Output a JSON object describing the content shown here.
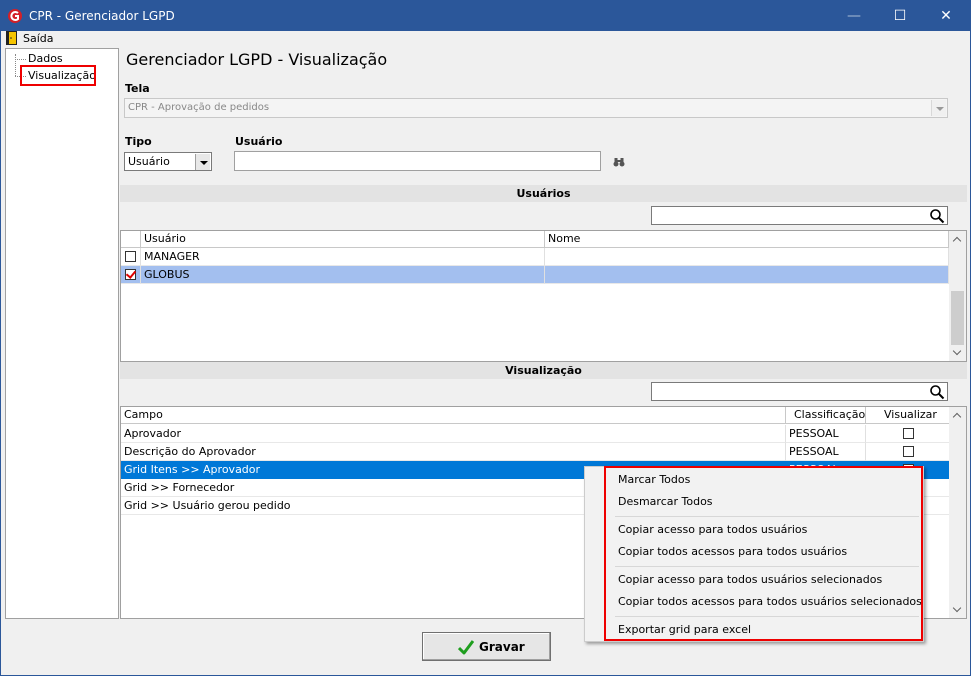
{
  "window": {
    "title": "CPR - Gerenciador LGPD",
    "minimize": "—",
    "maximize": "☐",
    "close": "✕"
  },
  "menu": {
    "exit_label": "Saída"
  },
  "tree": {
    "items": [
      "Dados",
      "Visualização"
    ]
  },
  "page": {
    "title": "Gerenciador LGPD - Visualização"
  },
  "form": {
    "tela_label": "Tela",
    "tela_value": "CPR - Aprovação de pedidos",
    "tipo_label": "Tipo",
    "tipo_value": "Usuário",
    "usuario_label": "Usuário",
    "usuario_value": ""
  },
  "users_section": {
    "title": "Usuários",
    "search_value": "",
    "columns": [
      "Usuário",
      "Nome"
    ],
    "rows": [
      {
        "usuario": "MANAGER",
        "nome": "",
        "checked": false
      },
      {
        "usuario": "GLOBUS",
        "nome": "",
        "checked": true
      }
    ]
  },
  "view_section": {
    "title": "Visualização",
    "search_value": "",
    "columns": [
      "Campo",
      "Classificação",
      "Visualizar"
    ],
    "rows": [
      {
        "campo": "Aprovador",
        "classificacao": "PESSOAL"
      },
      {
        "campo": "Descrição do Aprovador",
        "classificacao": "PESSOAL"
      },
      {
        "campo": "Grid  Itens >> Aprovador",
        "classificacao": "PESSOAL"
      },
      {
        "campo": "Grid >> Fornecedor",
        "classificacao": ""
      },
      {
        "campo": "Grid >> Usuário gerou pedido",
        "classificacao": ""
      }
    ]
  },
  "context_menu": {
    "items": [
      "Marcar Todos",
      "Desmarcar Todos",
      "Copiar acesso para todos usuários",
      "Copiar todos acessos para todos usuários",
      "Copiar acesso para todos usuários selecionados",
      "Copiar todos acessos para todos usuários selecionados",
      "Exportar grid para excel"
    ]
  },
  "footer": {
    "save_label": "Gravar"
  },
  "colors": {
    "titlebar": "#2b579a",
    "selection": "#0078d7",
    "row_highlight": "#a3bfef",
    "annotation": "#e00000"
  }
}
